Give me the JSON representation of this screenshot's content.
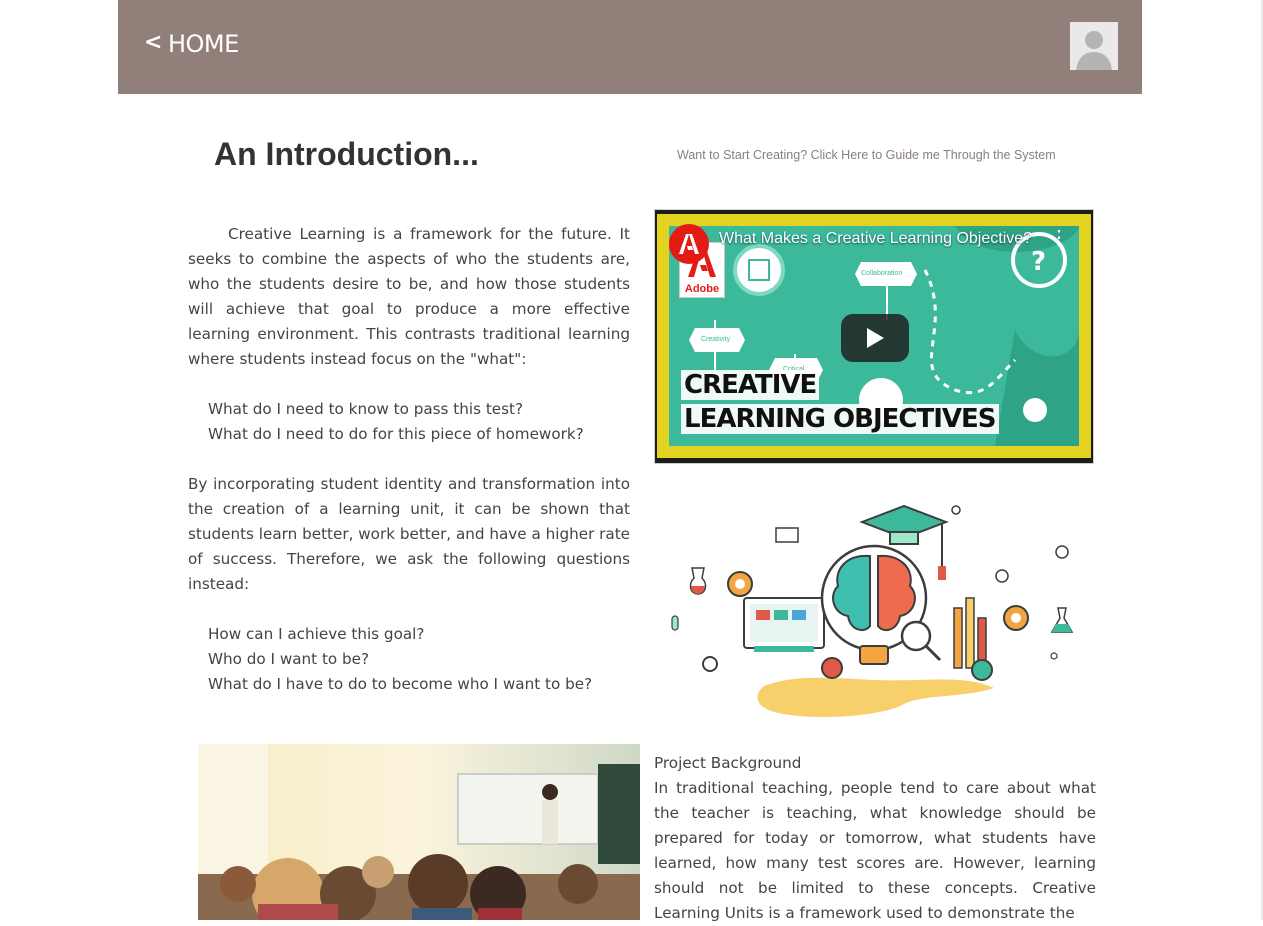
{
  "header": {
    "home_label": "HOME",
    "chevron_glyph": "<",
    "avatar_icon": "user-placeholder-icon"
  },
  "intro": {
    "title": "An Introduction...",
    "guide_link": "Want to Start Creating? Click Here to Guide me Through the System",
    "paragraph1": "Creative Learning is a framework for the future. It seeks to combine the aspects of who the students are, who the students desire to be, and how those students will achieve that goal to produce a more effective learning environment. This contrasts traditional learning where students instead focus on the \"what\":",
    "what_questions": [
      "What do I need to know to pass this test?",
      "What do I need to do for this piece of homework?"
    ],
    "paragraph2": "By incorporating student identity and transformation into the creation of a learning unit, it can be shown that students learn better, work better, and have a higher rate of success. Therefore, we ask the following questions instead:",
    "how_questions": [
      "How can I achieve this goal?",
      "Who do I want to be?",
      "What do I have to do to become who I want to be?"
    ]
  },
  "video": {
    "title": "What Makes a Creative Learning Objective?",
    "channel_logo_text": "Adobe",
    "headline_line1": "CREATIVE",
    "headline_line2": "LEARNING OBJECTIVES",
    "node_labels": [
      "Collaboration",
      "Creativity",
      "Critical"
    ],
    "menu_icon": "more-vertical-icon",
    "play_icon": "play-icon"
  },
  "background": {
    "heading": "Project Background",
    "text": "In traditional teaching, people tend to care about what the teacher is teaching, what knowledge should be prepared for today or tomorrow, what students have learned, how many test scores are. However, learning should not be limited to these concepts. Creative Learning Units is a framework used to demonstrate the"
  },
  "colors": {
    "header_bg": "#918079",
    "text": "#444444",
    "title": "#333333",
    "link": "#8a7f79",
    "video_green": "#3bb99a",
    "video_yellow": "#e3d21f"
  }
}
